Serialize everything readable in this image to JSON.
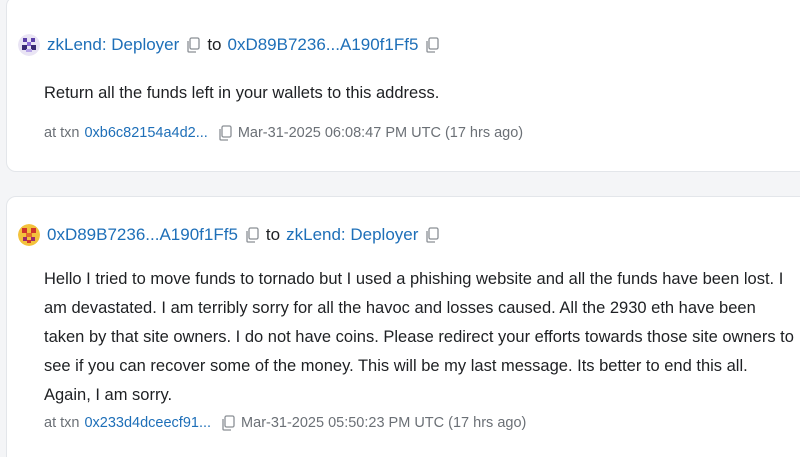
{
  "messages": [
    {
      "from": "zkLend: Deployer",
      "to_word": "to",
      "to": "0xD89B7236...A190f1Ff5",
      "body": "Return all the funds left in your wallets to this address.",
      "at_txn_label": "at txn",
      "txn": "0xb6c82154a4d2...",
      "timestamp": "Mar-31-2025 06:08:47 PM UTC (17 hrs ago)",
      "avatar_icon": "purple-blockie-avatar-icon"
    },
    {
      "from": "0xD89B7236...A190f1Ff5",
      "to_word": "to",
      "to": "zkLend: Deployer",
      "body": "Hello I tried to move funds to tornado but I used a phishing website and all the funds have been lost. I am devastated. I am terribly sorry for all the havoc and losses caused. All the 2930 eth have been taken by that site owners. I do not have coins. Please redirect your efforts towards those site owners to see if you can recover some of the money. This will be my last message. Its better to end this all. Again, I am sorry.",
      "at_txn_label": "at txn",
      "txn": "0x233d4dceecf91...",
      "timestamp": "Mar-31-2025 05:50:23 PM UTC (17 hrs ago)",
      "avatar_icon": "red-yellow-blockie-avatar-icon"
    }
  ],
  "colors": {
    "link": "#1e6fb8",
    "text": "#1e2023",
    "muted": "#6b7076",
    "card_border": "#e3e6ea"
  }
}
